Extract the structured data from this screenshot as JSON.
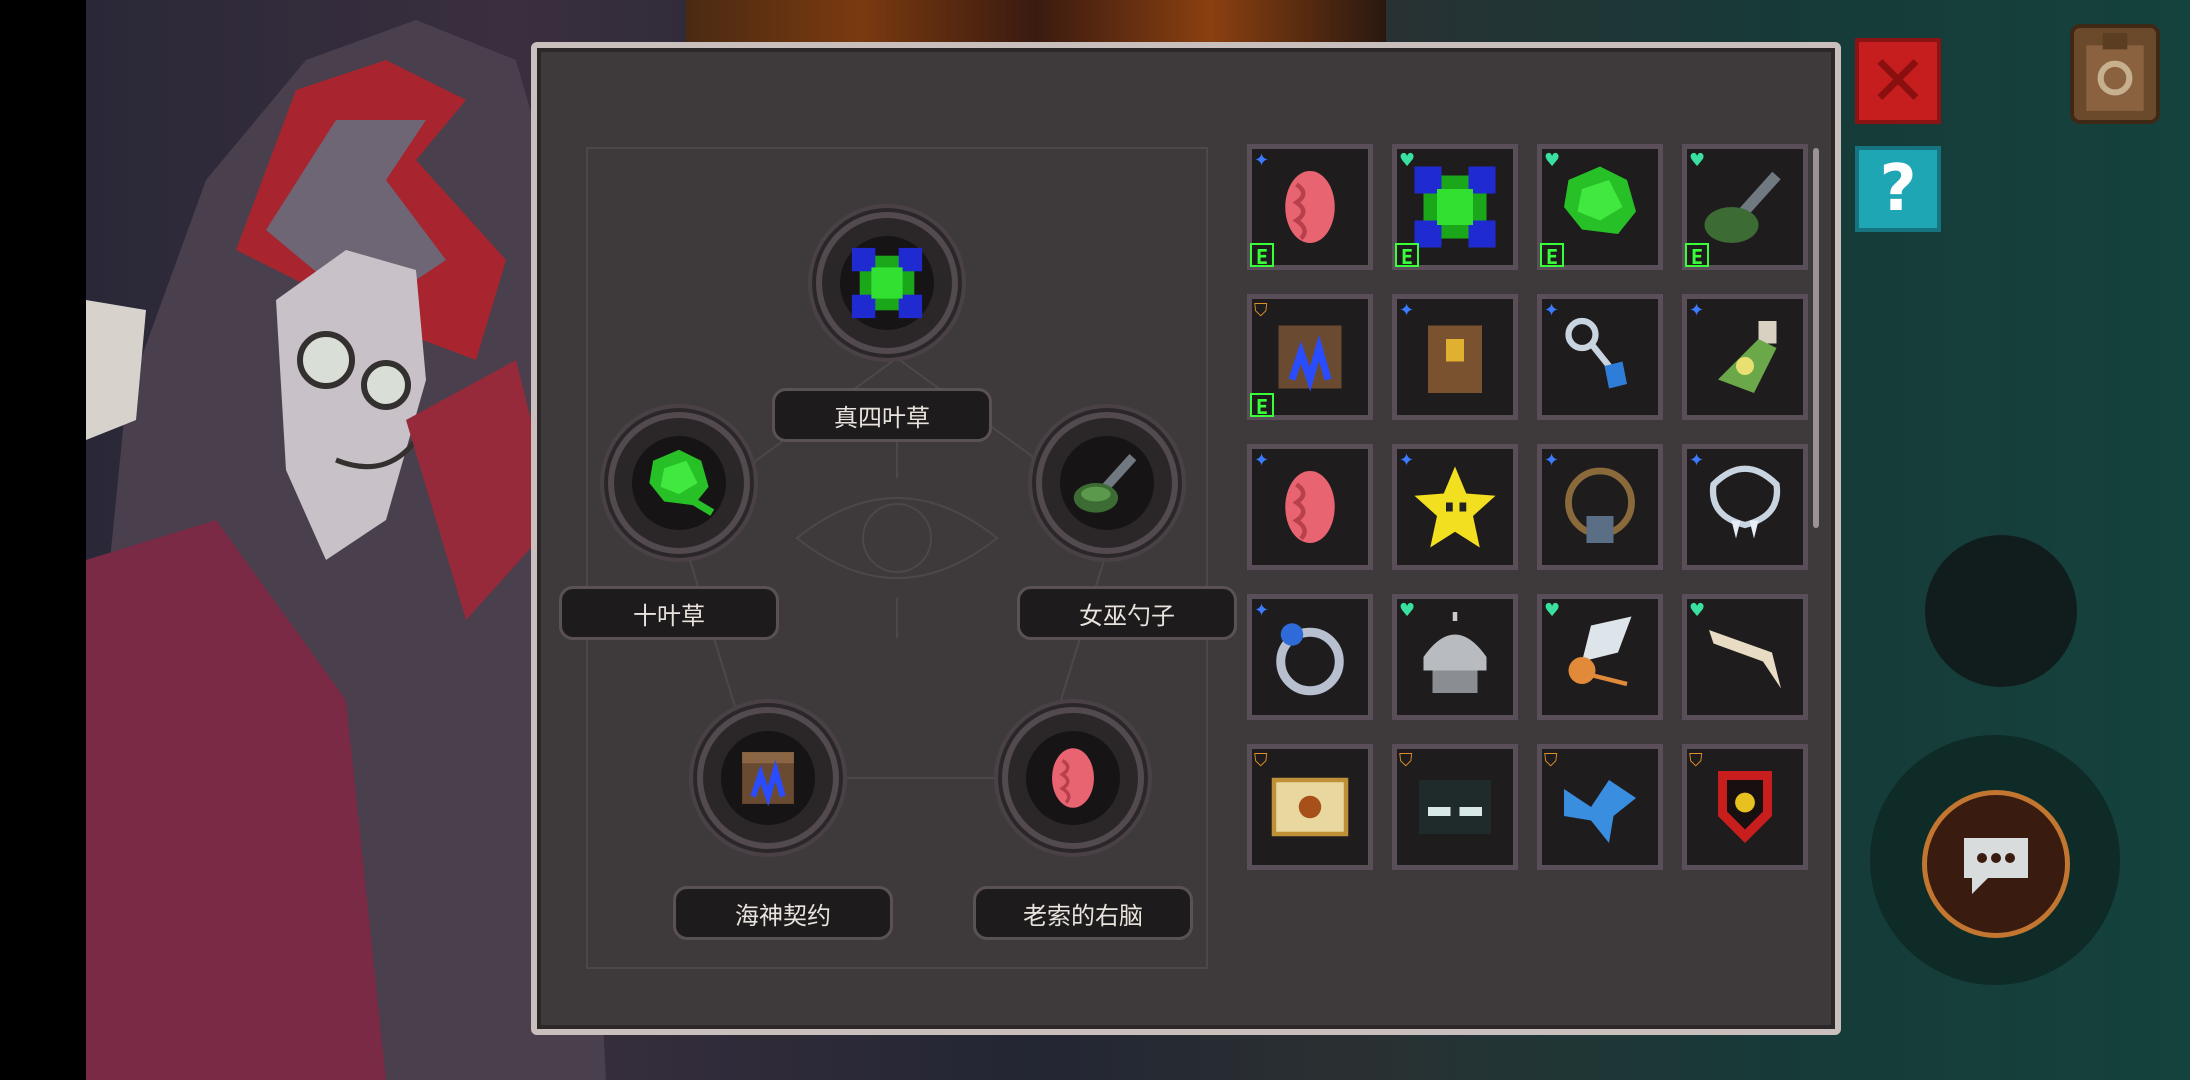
{
  "tree_nodes": [
    {
      "id": "top",
      "label": "真四叶草",
      "icon": "green-four-leaf-clover-icon"
    },
    {
      "id": "left",
      "label": "十叶草",
      "icon": "green-ten-leaf-clover-icon"
    },
    {
      "id": "right",
      "label": "女巫勺子",
      "icon": "witch-spoon-icon"
    },
    {
      "id": "bottom_left",
      "label": "海神契约",
      "icon": "poseidon-contract-scroll-icon"
    },
    {
      "id": "bottom_right",
      "label": "老索的右脑",
      "icon": "right-brain-icon"
    }
  ],
  "inventory": [
    [
      {
        "icon": "brain-icon",
        "badge": "blue-star",
        "e": true
      },
      {
        "icon": "four-leaf-clover-icon",
        "badge": "green-heart",
        "e": true
      },
      {
        "icon": "ten-leaf-clover-icon",
        "badge": "green-heart",
        "e": true
      },
      {
        "icon": "witch-spoon-icon",
        "badge": "green-heart",
        "e": true
      }
    ],
    [
      {
        "icon": "contract-scroll-icon",
        "badge": "orange-shield",
        "e": true
      },
      {
        "icon": "leather-backpack-icon",
        "badge": "blue-star",
        "e": false
      },
      {
        "icon": "chain-pendant-icon",
        "badge": "blue-star",
        "e": false
      },
      {
        "icon": "potion-bottle-icon",
        "badge": "blue-star",
        "e": false
      }
    ],
    [
      {
        "icon": "brain-icon",
        "badge": "blue-star",
        "e": false
      },
      {
        "icon": "yellow-star-icon",
        "badge": "blue-star",
        "e": false
      },
      {
        "icon": "skull-necklace-icon",
        "badge": "blue-star",
        "e": false
      },
      {
        "icon": "fang-necklace-icon",
        "badge": "blue-star",
        "e": false
      }
    ],
    [
      {
        "icon": "sapphire-ring-icon",
        "badge": "blue-star",
        "e": false
      },
      {
        "icon": "silver-helmet-icon",
        "badge": "green-heart",
        "e": false
      },
      {
        "icon": "winged-feather-icon",
        "badge": "green-heart",
        "e": false
      },
      {
        "icon": "bone-jaw-icon",
        "badge": "green-heart",
        "e": false
      }
    ],
    [
      {
        "icon": "eye-envelope-icon",
        "badge": "orange-shield",
        "e": false
      },
      {
        "icon": "dark-goggles-icon",
        "badge": "orange-shield",
        "e": false
      },
      {
        "icon": "blue-bird-icon",
        "badge": "orange-shield",
        "e": false
      },
      {
        "icon": "eye-shield-icon",
        "badge": "orange-shield",
        "e": false
      }
    ]
  ],
  "e_label": "E",
  "buttons": {
    "close": "close-icon",
    "help": "?",
    "bag": "backpack-icon",
    "chat": "chat-bubble-icon"
  },
  "colors": {
    "panel": "#3e3a3c",
    "close": "#c61e1e",
    "help": "#1fa6b4",
    "e_badge": "#39ff3a",
    "blue_star": "#3a7bff",
    "green_heart": "#39e0a0",
    "orange_shield": "#e0902a"
  }
}
